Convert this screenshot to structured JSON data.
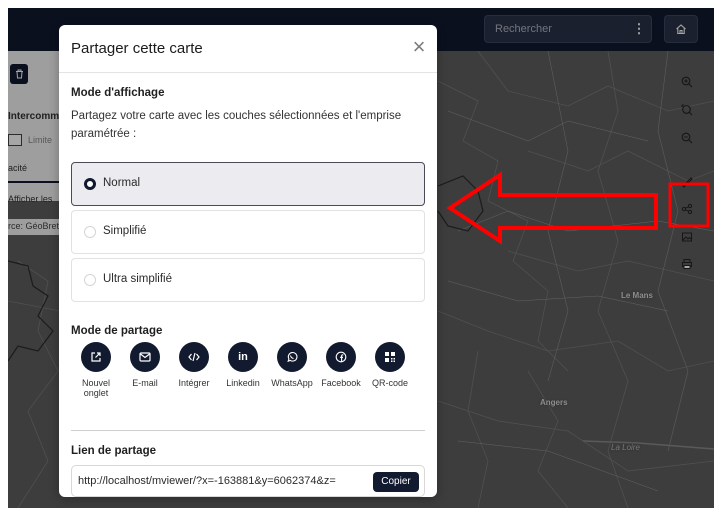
{
  "topbar": {
    "search_placeholder": "Rechercher",
    "kebab_glyph": "⋮",
    "home_icon": "home-icon"
  },
  "map": {
    "labels": [
      "Le Mans",
      "Angers",
      "La Loire"
    ]
  },
  "left_panel": {
    "layer_title": "Intercomm",
    "checkbox_label": "Limite",
    "opacity_label": "acité",
    "show_label": "Afficher les",
    "source_label": "rce: GéoBret"
  },
  "right_toolbar": [
    "zoom-in-icon",
    "zoom-extent-icon",
    "zoom-out-icon",
    "ruler-icon",
    "share-icon",
    "image-icon",
    "print-icon"
  ],
  "modal": {
    "title": "Partager cette carte",
    "close_glyph": "×",
    "display_mode": {
      "title": "Mode d'affichage",
      "description": "Partagez votre carte avec les couches sélectionnées et l'emprise paramétrée :",
      "options": [
        {
          "label": "Normal",
          "selected": true
        },
        {
          "label": "Simplifié",
          "selected": false
        },
        {
          "label": "Ultra simplifié",
          "selected": false
        }
      ]
    },
    "share_mode": {
      "title": "Mode de partage",
      "items": [
        {
          "label": "Nouvel onglet",
          "icon": "external-link-icon"
        },
        {
          "label": "E-mail",
          "icon": "mail-icon"
        },
        {
          "label": "Intégrer",
          "icon": "code-icon"
        },
        {
          "label": "Linkedin",
          "icon": "linkedin-icon",
          "glyph": "in"
        },
        {
          "label": "WhatsApp",
          "icon": "whatsapp-icon"
        },
        {
          "label": "Facebook",
          "icon": "facebook-icon"
        },
        {
          "label": "QR-code",
          "icon": "qr-code-icon"
        }
      ]
    },
    "share_link": {
      "title": "Lien de partage",
      "value": "http://localhost/mviewer/?x=-163881&y=6062374&z=",
      "copy_label": "Copier"
    }
  },
  "colors": {
    "primary": "#121a30",
    "annotation": "#ff0000"
  }
}
